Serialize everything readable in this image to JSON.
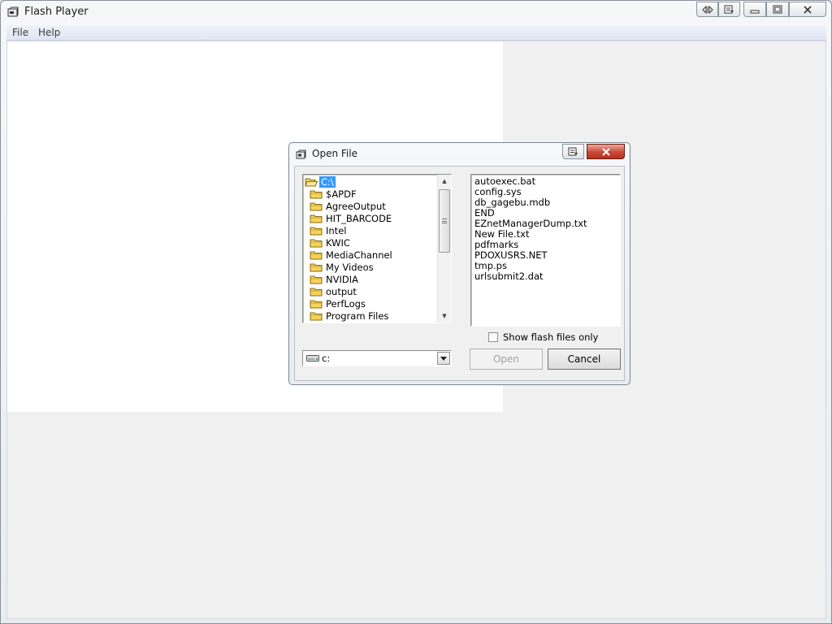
{
  "window": {
    "title": "Flash Player"
  },
  "menubar": {
    "items": [
      "File",
      "Help"
    ]
  },
  "dialog": {
    "title": "Open File",
    "folders": [
      {
        "label": "C:\\",
        "selected": true,
        "open": true
      },
      {
        "label": "$APDF"
      },
      {
        "label": "AgreeOutput"
      },
      {
        "label": "HIT_BARCODE"
      },
      {
        "label": "Intel"
      },
      {
        "label": "KWIC"
      },
      {
        "label": "MediaChannel"
      },
      {
        "label": "My Videos"
      },
      {
        "label": "NVIDIA"
      },
      {
        "label": "output"
      },
      {
        "label": "PerfLogs"
      },
      {
        "label": "Program Files"
      }
    ],
    "files": [
      "autoexec.bat",
      "config.sys",
      "db_gagebu.mdb",
      "END",
      "EZnetManagerDump.txt",
      "New File.txt",
      "pdfmarks",
      "PDOXUSRS.NET",
      "tmp.ps",
      "urlsubmit2.dat"
    ],
    "checkbox": {
      "label": "Show flash files only",
      "checked": false
    },
    "drive": {
      "value": "c:"
    },
    "buttons": {
      "open": "Open",
      "cancel": "Cancel",
      "open_disabled": true
    }
  },
  "colors": {
    "selection": "#3399ff",
    "stage": "#ffffff",
    "client": "#f0f0f0",
    "close_button": "#c84a36",
    "folder": "#f5d35c"
  },
  "icons": {
    "app": "flash-player-app-icon",
    "folder": "folder-icon",
    "drive": "hard-drive-icon"
  }
}
